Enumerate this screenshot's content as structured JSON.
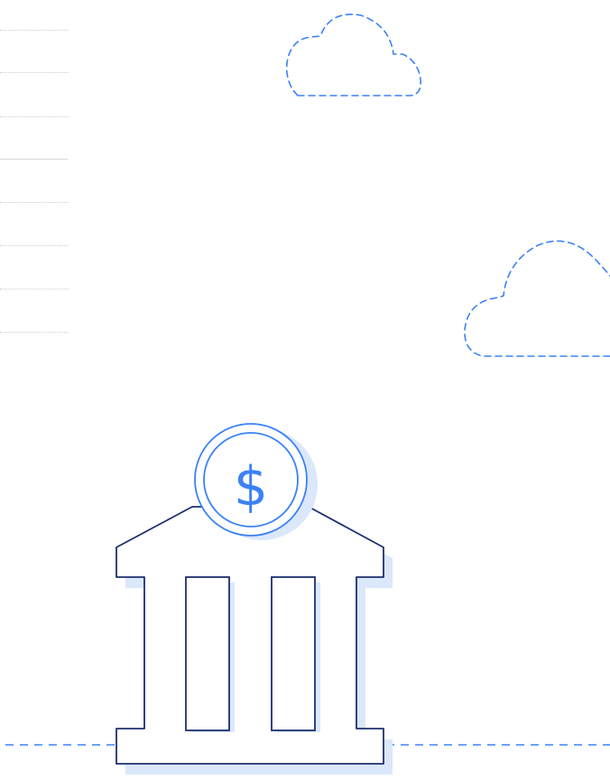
{
  "illustration": {
    "coin_symbol": "$",
    "colors": {
      "outline_navy": "#1c2f6e",
      "accent_blue": "#3b82f6",
      "shadow_blue": "#dbe7fb",
      "guide_gray": "#c9ced6",
      "background": "#ffffff"
    },
    "icons": [
      "bank-building-icon",
      "dollar-coin-icon",
      "cloud-icon",
      "cloud-icon"
    ]
  }
}
